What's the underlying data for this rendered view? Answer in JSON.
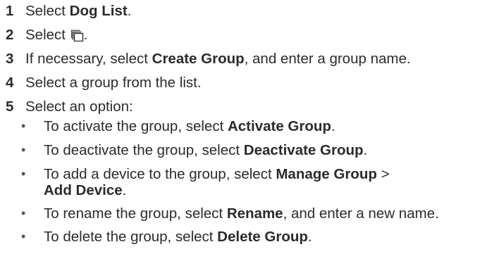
{
  "steps": [
    {
      "num": "1",
      "pre": "Select ",
      "bold": "Dog List",
      "post": "."
    },
    {
      "num": "2",
      "pre": "Select ",
      "icon": "stacked-pages-icon",
      "post": "."
    },
    {
      "num": "3",
      "pre": "If necessary, select ",
      "bold": "Create Group",
      "post": ", and enter a group name."
    },
    {
      "num": "4",
      "text": "Select a group from the list."
    },
    {
      "num": "5",
      "text": "Select an option:"
    }
  ],
  "options": [
    {
      "pre": "To activate the group, select ",
      "bold": "Activate Group",
      "post": "."
    },
    {
      "pre": "To deactivate the group, select ",
      "bold": "Deactivate Group",
      "post": "."
    },
    {
      "pre": "To add a device to the group, select ",
      "bold": "Manage Group",
      "mid": " > ",
      "bold2": "Add Device",
      "post": "."
    },
    {
      "pre": "To rename the group, select ",
      "bold": "Rename",
      "post": ", and enter a new name."
    },
    {
      "pre": "To delete the group, select ",
      "bold": "Delete Group",
      "post": "."
    }
  ],
  "bullet_char": "•"
}
